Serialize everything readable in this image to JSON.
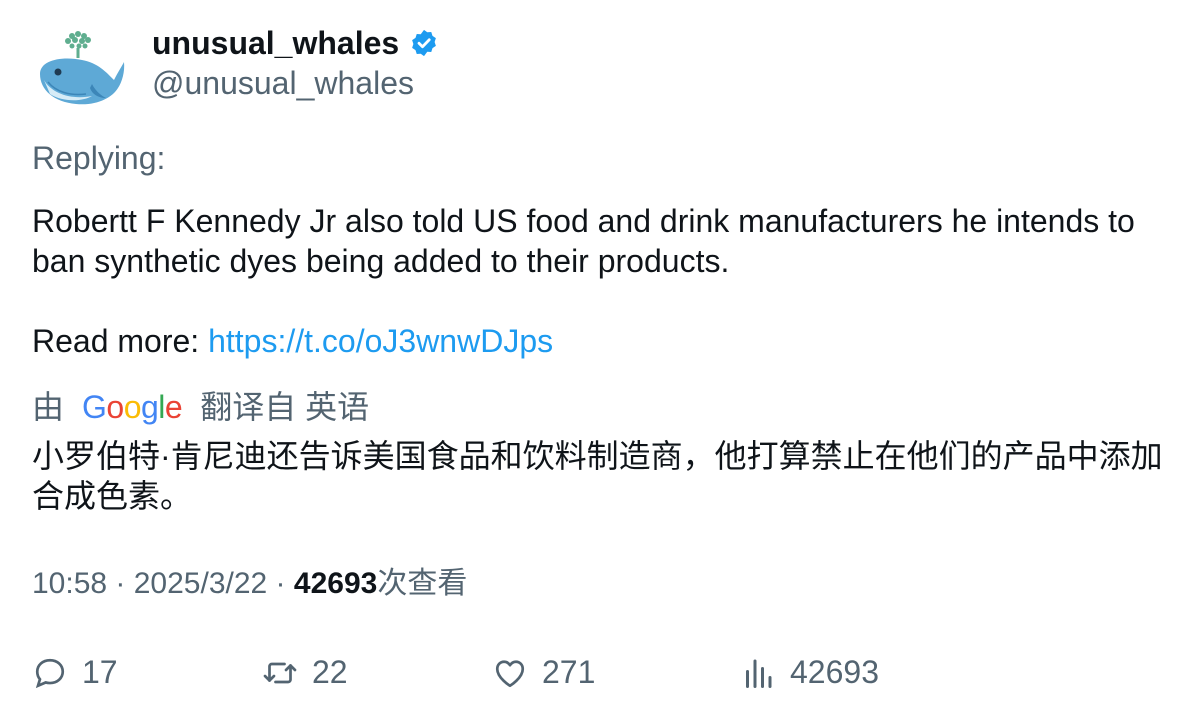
{
  "author": {
    "display_name": "unusual_whales",
    "handle": "@unusual_whales",
    "avatar_icon": "whale-icon",
    "verified_icon": "verified-badge-icon"
  },
  "tweet": {
    "replying": "Replying:",
    "text": "Robertt F Kennedy Jr also told US food and drink manufacturers he intends to ban synthetic dyes being added to their products.",
    "read_more_label": "Read more: ",
    "link": "https://t.co/oJ3wnwDJps"
  },
  "translation": {
    "by": "由",
    "provider_letters": [
      "G",
      "o",
      "o",
      "g",
      "l",
      "e"
    ],
    "from_label": "翻译自 英语",
    "text": "小罗伯特·肯尼迪还告诉美国食品和饮料制造商，他打算禁止在他们的产品中添加合成色素。"
  },
  "meta": {
    "time": "10:58",
    "sep1": " · ",
    "date": "2025/3/22",
    "sep2": " · ",
    "views": "42693",
    "views_label": "次查看"
  },
  "actions": {
    "replies": "17",
    "retweets": "22",
    "likes": "271",
    "views": "42693"
  },
  "colors": {
    "link": "#1d9bf0",
    "secondary": "#536471",
    "primary": "#0f1419"
  }
}
